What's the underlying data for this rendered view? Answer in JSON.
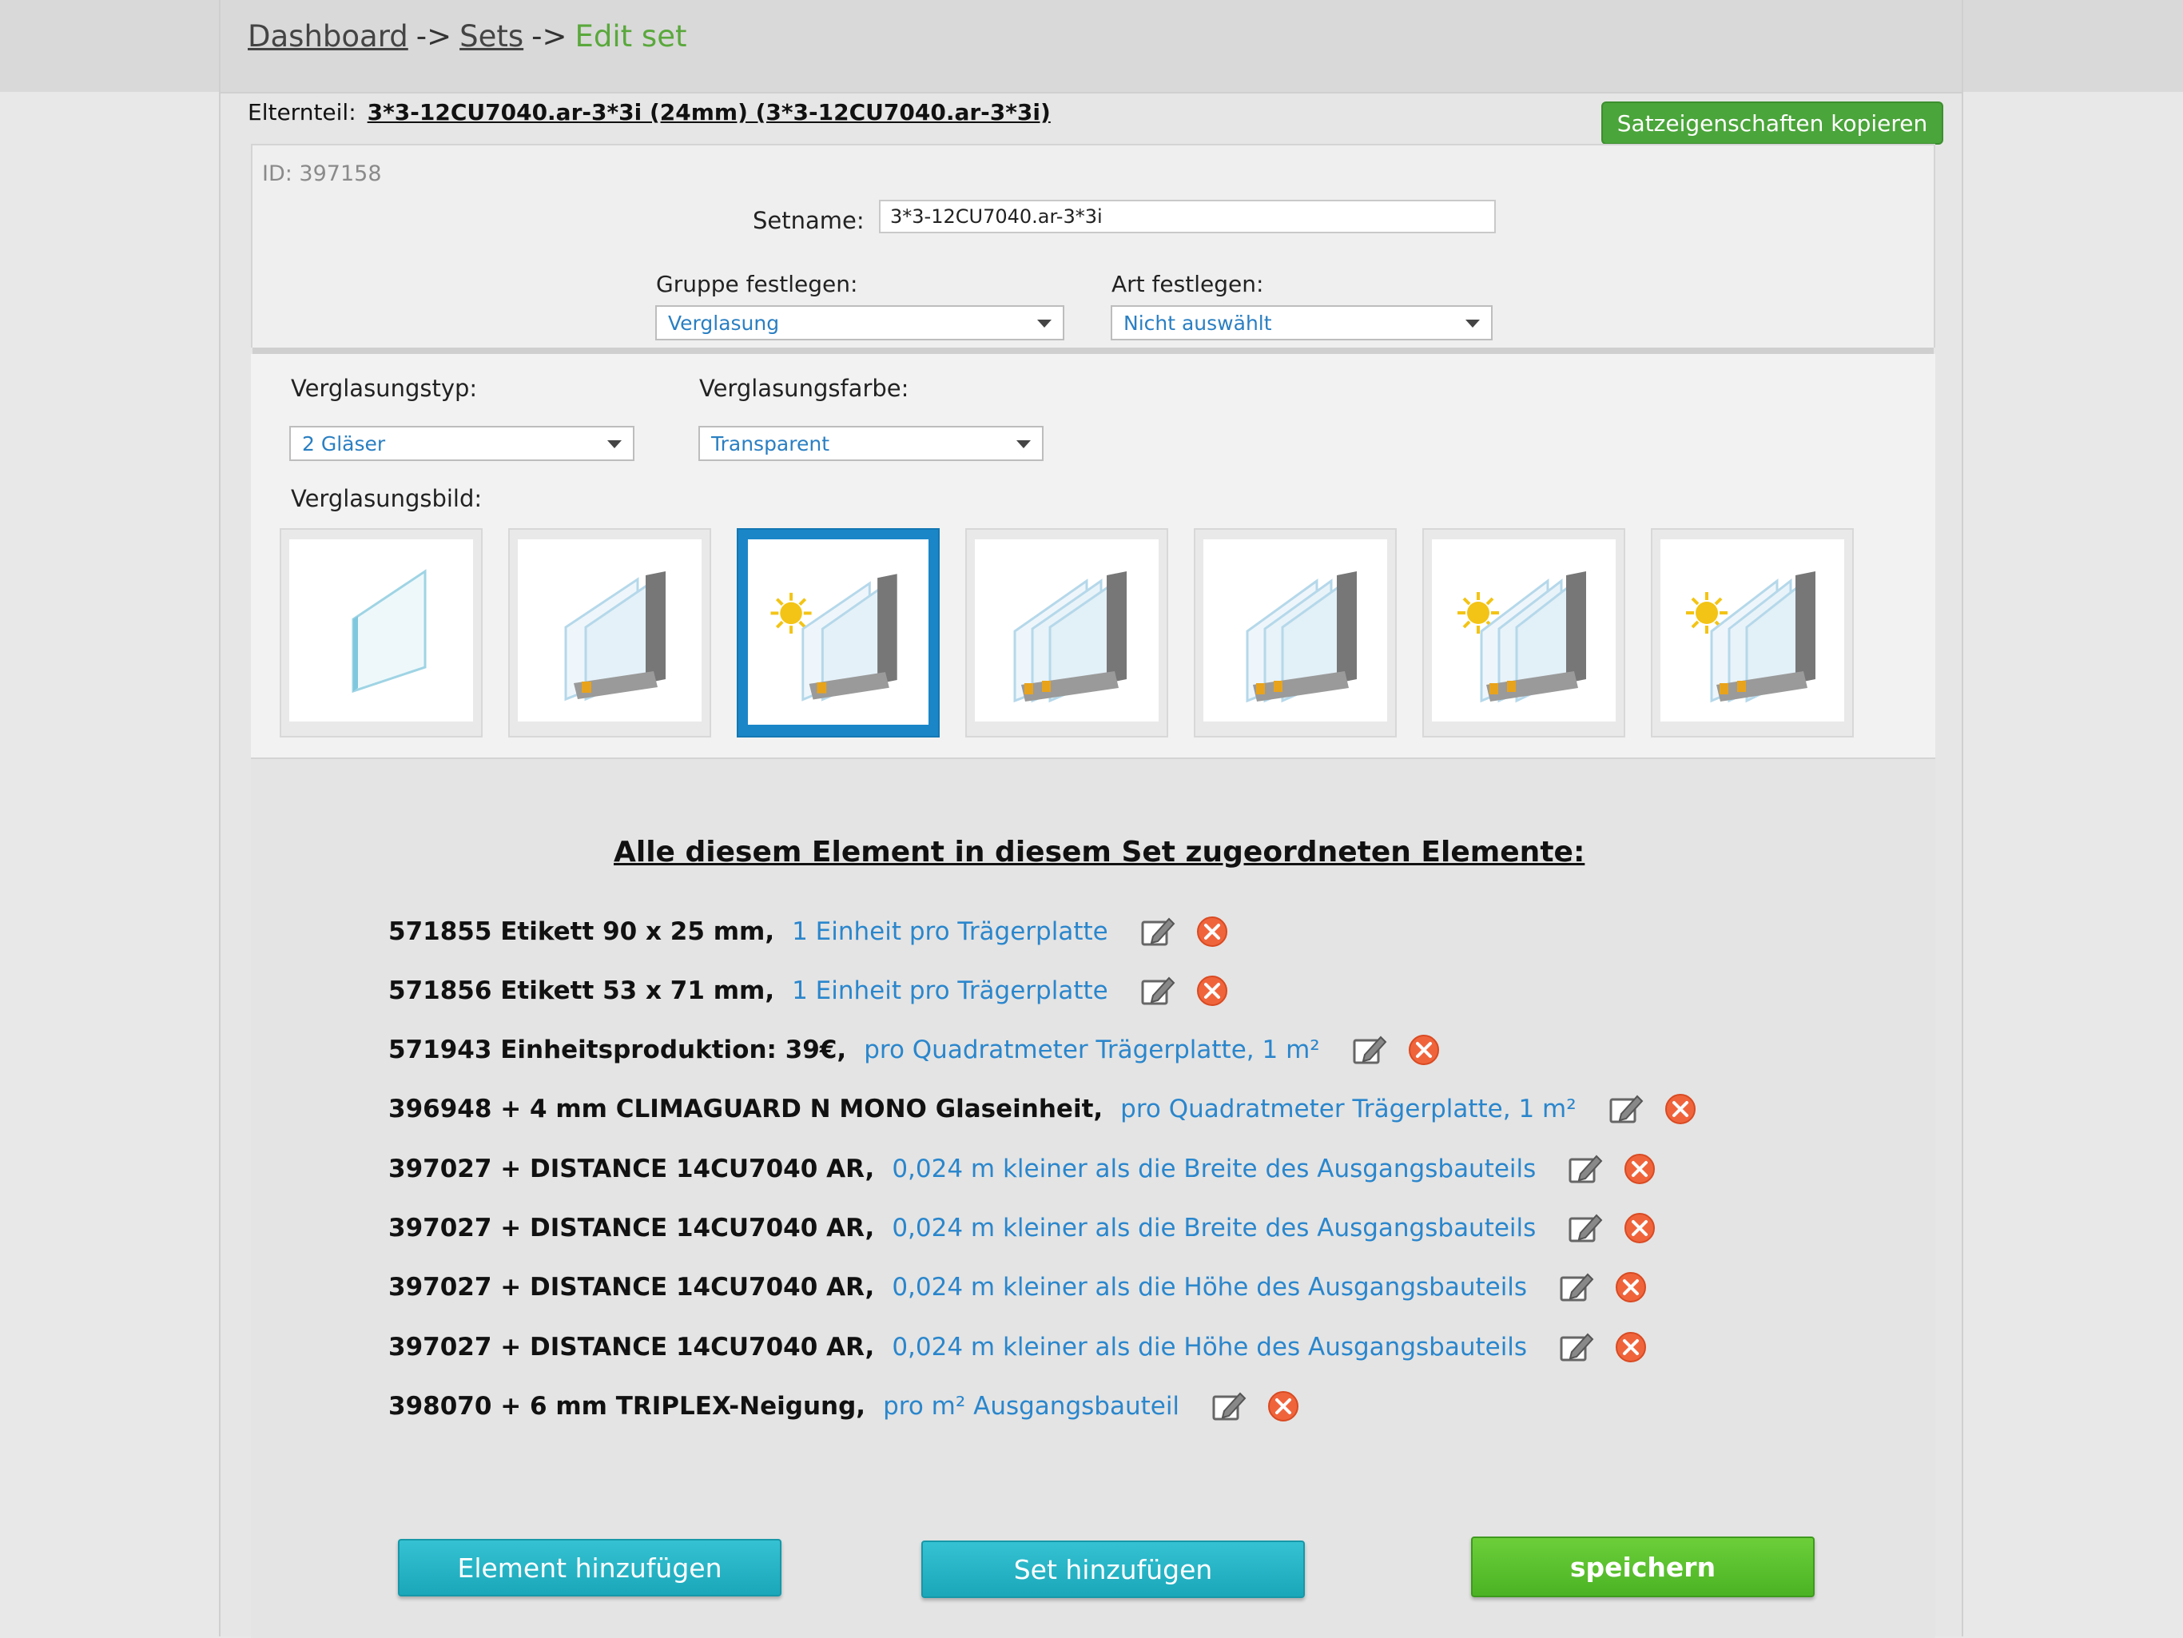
{
  "breadcrumb": {
    "dashboard": "Dashboard",
    "sets": "Sets",
    "arrow": "->",
    "current": "Edit set"
  },
  "parent": {
    "label": "Elternteil:",
    "value": "3*3-12CU7040.ar-3*3i (24mm) (3*3-12CU7040.ar-3*3i)"
  },
  "copy_button": "Satzeigenschaften kopieren",
  "set_id": "ID: 397158",
  "setname": {
    "label": "Setname:",
    "value": "3*3-12CU7040.ar-3*3i"
  },
  "group": {
    "label": "Gruppe festlegen:",
    "value": "Verglasung"
  },
  "art": {
    "label": "Art festlegen:",
    "value": "Nicht auswählt"
  },
  "glazing_type": {
    "label": "Verglasungstyp:",
    "value": "2 Gläser"
  },
  "glazing_color": {
    "label": "Verglasungsfarbe:",
    "value": "Transparent"
  },
  "glazing_image": {
    "label": "Verglasungsbild:",
    "selected_index": 2,
    "thumbnails": [
      {
        "icon": "single-glass-pane-icon"
      },
      {
        "icon": "double-glazing-frame-icon"
      },
      {
        "icon": "double-glazing-sun-icon"
      },
      {
        "icon": "triple-glazing-frame-icon"
      },
      {
        "icon": "triple-glazing-frame-alt-icon"
      },
      {
        "icon": "triple-glazing-sun-icon"
      },
      {
        "icon": "triple-glazing-sun-alt-icon"
      }
    ]
  },
  "elements": {
    "title": "Alle diesem Element in diesem Set zugeordneten Elemente:",
    "items": [
      {
        "name": "571855 Etikett 90 x 25 mm,",
        "qty": "1 Einheit pro Trägerplatte"
      },
      {
        "name": "571856 Etikett 53 x 71 mm,",
        "qty": "1 Einheit pro Trägerplatte"
      },
      {
        "name": "571943 Einheitsproduktion: 39€,",
        "qty": "pro Quadratmeter Trägerplatte, 1 m²"
      },
      {
        "name": "396948 + 4 mm CLIMAGUARD N MONO Glaseinheit,",
        "qty": "pro Quadratmeter Trägerplatte, 1 m²"
      },
      {
        "name": "397027 + DISTANCE 14CU7040 AR,",
        "qty": "0,024 m kleiner als die Breite des Ausgangsbauteils"
      },
      {
        "name": "397027 + DISTANCE 14CU7040 AR,",
        "qty": "0,024 m kleiner als die Breite des Ausgangsbauteils"
      },
      {
        "name": "397027 + DISTANCE 14CU7040 AR,",
        "qty": "0,024 m kleiner als die Höhe des Ausgangsbauteils"
      },
      {
        "name": "397027 + DISTANCE 14CU7040 AR,",
        "qty": "0,024 m kleiner als die Höhe des Ausgangsbauteils"
      },
      {
        "name": "398070 + 6 mm TRIPLEX-Neigung,",
        "qty": "pro m² Ausgangsbauteil"
      }
    ]
  },
  "buttons": {
    "add_element": "Element hinzufügen",
    "add_set": "Set hinzufügen",
    "save": "speichern"
  },
  "colors": {
    "accent_green": "#4aa53a",
    "link_blue": "#2a86cc",
    "teal_button": "#1aa7b9",
    "save_green": "#4bb323",
    "selected_blue": "#1a86c8",
    "delete_orange": "#f0643c"
  }
}
